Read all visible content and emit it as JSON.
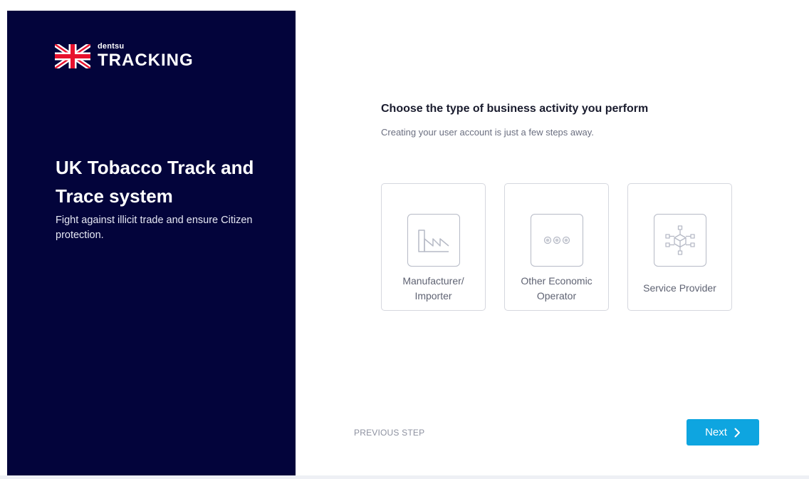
{
  "brand": {
    "company": "dentsu",
    "product": "TRACKING",
    "flag_icon": "uk-flag-icon"
  },
  "hero": {
    "title": "UK Tobacco Track and Trace system",
    "subtitle": "Fight against illicit trade and ensure Citizen protection."
  },
  "form": {
    "heading": "Choose the type of business activity you perform",
    "subheading": "Creating your user account is just a few steps away.",
    "options": [
      {
        "label": "Manufacturer/\nImporter",
        "icon": "factory-icon"
      },
      {
        "label": "Other Economic\nOperator",
        "icon": "dots-icon"
      },
      {
        "label": "Service Provider",
        "icon": "network-cube-icon"
      }
    ]
  },
  "footer": {
    "previous_label": "PREVIOUS STEP",
    "next_label": "Next"
  },
  "colors": {
    "panel_bg": "#03043b",
    "accent": "#0ea5e0"
  }
}
